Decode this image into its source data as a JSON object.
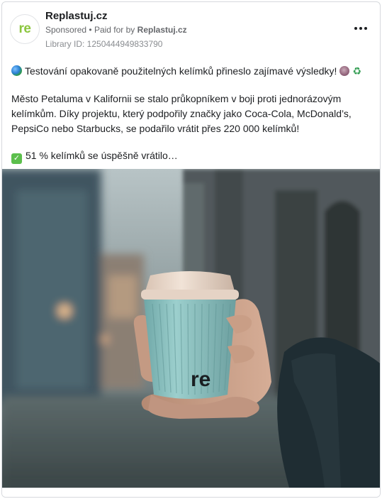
{
  "ad": {
    "page_name": "Replastuj.cz",
    "avatar_text": "re",
    "sponsored_label": "Sponsored",
    "paid_for_prefix": "Paid for by",
    "paid_for_by": "Replastuj.cz",
    "library_id": "Library ID: 1250444949833790"
  },
  "post": {
    "line1": "Testování opakovaně použitelných kelímků přineslo zajímavé výsledky!",
    "paragraph2": "Město Petaluma v Kalifornii se stalo průkopníkem v boji proti jednorázovým kelímkům. Díky projektu, který podpořily značky jako Coca-Cola, McDonald’s, PepsiCo nebo Starbucks, se podařilo vrátit přes 220 000 kelímků!",
    "line3": "51 % kelímků se úspěšně vrátilo…",
    "icons": [
      "globe-emoji",
      "face-emoji",
      "recycle-emoji",
      "check-emoji"
    ]
  },
  "image": {
    "cup_logo_text": "re",
    "colors": {
      "cup": "#8fc4c3",
      "lid": "#ead9cc",
      "jacket": "#1f2d33"
    }
  }
}
